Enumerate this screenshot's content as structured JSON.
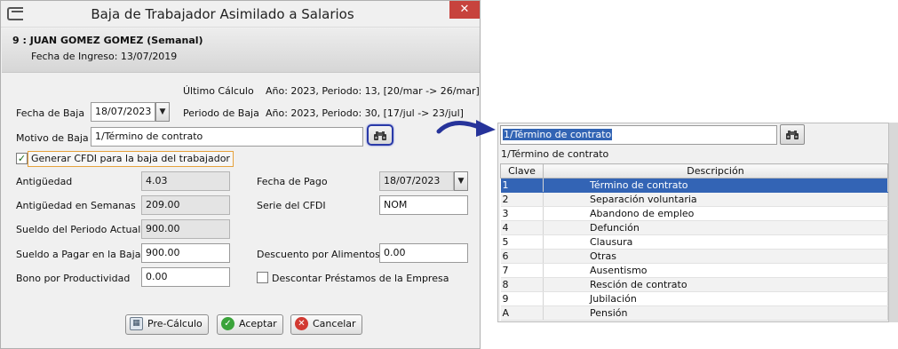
{
  "dialog": {
    "title": "Baja de Trabajador Asimilado a Salarios",
    "close_glyph": "✕",
    "employee_name": "9 : JUAN GOMEZ GOMEZ (Semanal)",
    "hire_date_text": "Fecha de Ingreso: 13/07/2019",
    "ultimo_calculo_label": "Último Cálculo",
    "ultimo_calculo_value": "Año: 2023, Periodo: 13, [20/mar -> 26/mar]",
    "fecha_baja_label": "Fecha de Baja",
    "fecha_baja_value": "18/07/2023",
    "periodo_baja_label": "Periodo de Baja",
    "periodo_baja_value": "Año: 2023, Periodo: 30, [17/jul -> 23/jul]",
    "motivo_label": "Motivo de Baja",
    "motivo_value": "1/Término de contrato",
    "cfdi_checkbox_label": "Generar CFDI para la baja del trabajador",
    "cfdi_checked": true,
    "antiguedad_label": "Antigüedad",
    "antiguedad_value": "4.03",
    "antiguedad_semanas_label": "Antigüedad en Semanas",
    "antiguedad_semanas_value": "209.00",
    "sueldo_periodo_label": "Sueldo del Periodo Actual",
    "sueldo_periodo_value": "900.00",
    "sueldo_pagar_label": "Sueldo a Pagar en la Baja",
    "sueldo_pagar_value": "900.00",
    "bono_label": "Bono por Productividad",
    "bono_value": "0.00",
    "fecha_pago_label": "Fecha de Pago",
    "fecha_pago_value": "18/07/2023",
    "serie_label": "Serie del CFDI",
    "serie_value": "NOM",
    "descuento_label": "Descuento por Alimentos",
    "descuento_value": "0.00",
    "descontar_label": "Descontar Préstamos de la Empresa",
    "descontar_checked": false,
    "precalculo_label": "Pre-Cálculo",
    "aceptar_label": "Aceptar",
    "cancelar_label": "Cancelar"
  },
  "popup": {
    "search_value": "1/Término de contrato",
    "caption": "1/Término de contrato",
    "columns": [
      "Clave",
      "Descripción"
    ],
    "rows": [
      {
        "clave": "1",
        "descripcion": "Término de contrato"
      },
      {
        "clave": "2",
        "descripcion": "Separación voluntaria"
      },
      {
        "clave": "3",
        "descripcion": "Abandono de empleo"
      },
      {
        "clave": "4",
        "descripcion": "Defunción"
      },
      {
        "clave": "5",
        "descripcion": "Clausura"
      },
      {
        "clave": "6",
        "descripcion": "Otras"
      },
      {
        "clave": "7",
        "descripcion": "Ausentismo"
      },
      {
        "clave": "8",
        "descripcion": "Resción de contrato"
      },
      {
        "clave": "9",
        "descripcion": "Jubilación"
      },
      {
        "clave": "A",
        "descripcion": "Pensión"
      }
    ],
    "selected_row": 0
  },
  "colors": {
    "selection": "#3364b5",
    "close_button": "#c7433d",
    "highlight_border": "#2a3aa8",
    "cfdi_focus_border": "#e6a23c"
  },
  "icons": {
    "app": "window-icon",
    "close": "close-icon",
    "search": "binoculars-icon",
    "dropdown": "chevron-down-icon",
    "precalculo": "calculator-icon",
    "aceptar": "check-circle-icon",
    "cancelar": "cancel-circle-icon"
  }
}
